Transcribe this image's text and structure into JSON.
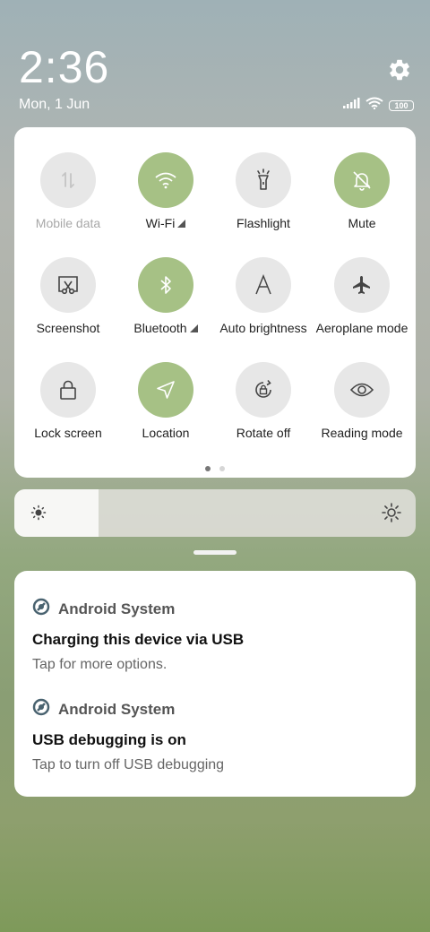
{
  "status_bar": {
    "time": "2:36",
    "date": "Mon, 1 Jun",
    "battery": "100"
  },
  "quick_settings": {
    "tiles": [
      {
        "label": "Mobile data",
        "icon": "mobile-data-icon",
        "state": "disabled"
      },
      {
        "label": "Wi-Fi",
        "icon": "wifi-icon",
        "state": "on"
      },
      {
        "label": "Flashlight",
        "icon": "flashlight-icon",
        "state": "off"
      },
      {
        "label": "Mute",
        "icon": "mute-icon",
        "state": "on"
      },
      {
        "label": "Screenshot",
        "icon": "screenshot-icon",
        "state": "off"
      },
      {
        "label": "Bluetooth",
        "icon": "bluetooth-icon",
        "state": "on"
      },
      {
        "label": "Auto brightness",
        "icon": "auto-brightness-icon",
        "state": "off"
      },
      {
        "label": "Aeroplane mode",
        "icon": "airplane-icon",
        "state": "off"
      },
      {
        "label": "Lock screen",
        "icon": "lock-icon",
        "state": "off"
      },
      {
        "label": "Location",
        "icon": "location-icon",
        "state": "on"
      },
      {
        "label": "Rotate off",
        "icon": "rotate-lock-icon",
        "state": "off"
      },
      {
        "label": "Reading mode",
        "icon": "eye-icon",
        "state": "off"
      }
    ],
    "page_count": 2,
    "active_page": 1
  },
  "brightness": {
    "level_fraction": 0.21
  },
  "notifications": [
    {
      "app": "Android System",
      "title": "Charging this device via USB",
      "text": "Tap for more options."
    },
    {
      "app": "Android System",
      "title": "USB debugging is on",
      "text": "Tap to turn off USB debugging"
    }
  ],
  "colors": {
    "active_tile": "#a6c185",
    "inactive_tile": "#e7e7e7"
  }
}
